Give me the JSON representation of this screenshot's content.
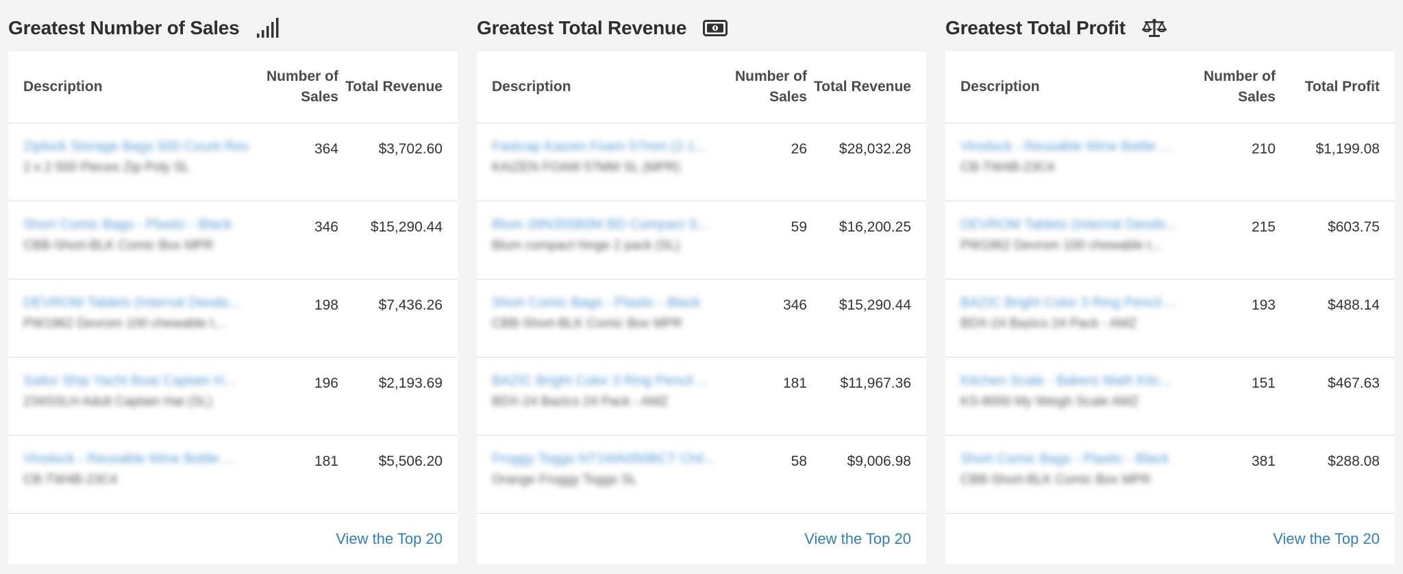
{
  "panels": [
    {
      "id": "sales",
      "title": "Greatest Number of Sales",
      "icon": "signal-bars-icon",
      "headers": {
        "desc": "Description",
        "n": "Number of Sales",
        "v": "Total Revenue"
      },
      "rows": [
        {
          "title": "Ziplock Storage Bags 500 Count Resealable...",
          "sub": "2 x 2 500 Pieces Zip Poly SL",
          "n": "364",
          "v": "$3,702.60"
        },
        {
          "title": "Short Comic Bags - Plastic - Black",
          "sub": "CBB-Short-BLK Comic Box MPR",
          "n": "346",
          "v": "$15,290.44"
        },
        {
          "title": "DEVROM Tablets (Internal Deodo...",
          "sub": "PW1962 Devrom 100 chewable t...",
          "n": "198",
          "v": "$7,436.26"
        },
        {
          "title": "Sailor Ship Yacht Boat Captain H...",
          "sub": "234SSLH Adult Captain Hat (SL)",
          "n": "196",
          "v": "$2,193.69"
        },
        {
          "title": "Vinolock - Reusable Wine Bottle ...",
          "sub": "CB-TW4B-23C4",
          "n": "181",
          "v": "$5,506.20"
        }
      ],
      "link": "View the Top 20"
    },
    {
      "id": "revenue",
      "title": "Greatest Total Revenue",
      "icon": "cash-bill-icon",
      "headers": {
        "desc": "Description",
        "n": "Number of Sales",
        "v": "Total Revenue"
      },
      "rows": [
        {
          "title": "Fastcap Kaizen Foam 57mm (2-1...",
          "sub": "KAIZEN FOAM 57MM SL (MPR)",
          "n": "26",
          "v": "$28,032.28"
        },
        {
          "title": "Blum 39N355B0M BD Compact S...",
          "sub": "Blum compact hinge 2 pack (SL)",
          "n": "59",
          "v": "$16,200.25"
        },
        {
          "title": "Short Comic Bags - Plastic - Black",
          "sub": "CBB-Short-BLK Comic Box MPR",
          "n": "346",
          "v": "$15,290.44"
        },
        {
          "title": "BAZIC Bright Color 3 Ring Pencil ...",
          "sub": "BDX-24 Bazics 24 Pack - AMZ",
          "n": "181",
          "v": "$11,967.36"
        },
        {
          "title": "Froggy Toggs NT1WA050BCT Chil...",
          "sub": "Orange Froggy Toggs SL",
          "n": "58",
          "v": "$9,006.98"
        }
      ],
      "link": "View the Top 20"
    },
    {
      "id": "profit",
      "title": "Greatest Total Profit",
      "icon": "balance-scale-icon",
      "headers": {
        "desc": "Description",
        "n": "Number of Sales",
        "v": "Total Profit"
      },
      "rows": [
        {
          "title": "Vinolock - Reusable Wine Bottle ...",
          "sub": "CB-TW4B-23C4",
          "n": "210",
          "v": "$1,199.08"
        },
        {
          "title": "DEVROM Tablets (Internal Deodo...",
          "sub": "PW1962 Devrom 100 chewable t...",
          "n": "215",
          "v": "$603.75"
        },
        {
          "title": "BAZIC Bright Color 3 Ring Pencil ...",
          "sub": "BDX-24 Bazics 24 Pack - AMZ",
          "n": "193",
          "v": "$488.14"
        },
        {
          "title": "Kitchen Scale - Bakers Math Kitc...",
          "sub": "KS-8000 My Weigh Scale AMZ",
          "n": "151",
          "v": "$467.63"
        },
        {
          "title": "Short Comic Bags - Plastic - Black",
          "sub": "CBB-Short-BLK Comic Box MPR",
          "n": "381",
          "v": "$288.08"
        }
      ],
      "link": "View the Top 20"
    }
  ]
}
